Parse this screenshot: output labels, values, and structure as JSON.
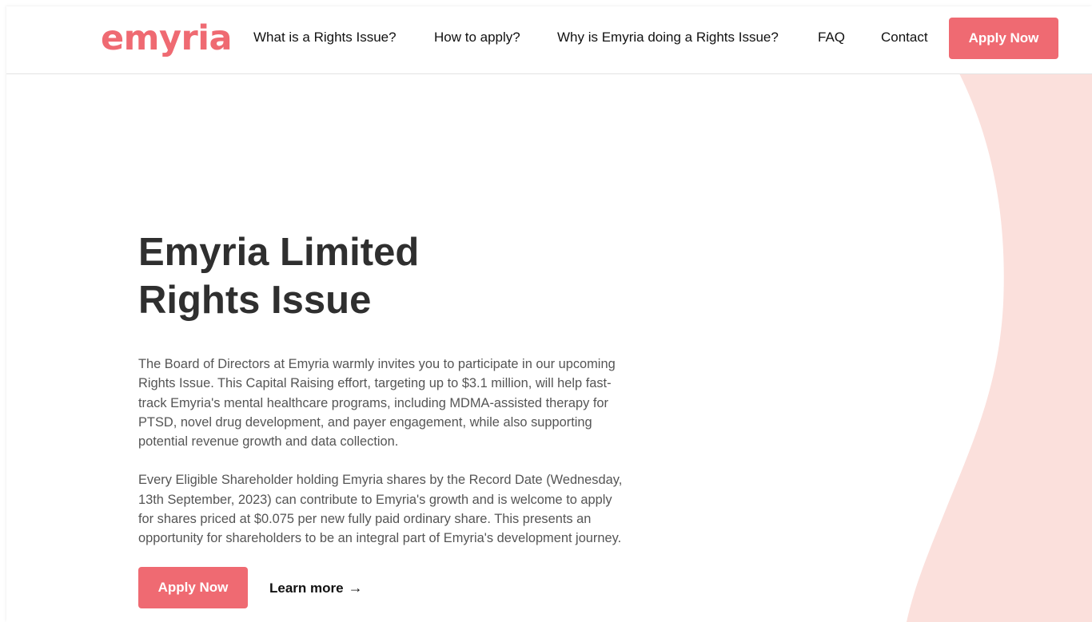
{
  "brand": {
    "logo_text": "emyria",
    "accent_color": "#ef6a72",
    "wave_color": "#fbe0dc"
  },
  "nav": {
    "items": [
      {
        "label": "What is a Rights Issue?"
      },
      {
        "label": "How to apply?"
      },
      {
        "label": "Why is Emyria doing a Rights Issue?"
      },
      {
        "label": "FAQ"
      },
      {
        "label": "Contact"
      }
    ],
    "apply_label": "Apply Now"
  },
  "hero": {
    "title_line1": "Emyria Limited",
    "title_line2": "Rights Issue",
    "paragraph1": "The Board of Directors at Emyria warmly invites you to participate in our upcoming Rights Issue. This Capital Raising effort, targeting up to $3.1 million, will help fast-track Emyria's mental healthcare programs, including MDMA-assisted therapy for PTSD, novel drug development, and payer engagement, while also supporting potential revenue growth and data collection.",
    "paragraph2": "Every Eligible Shareholder holding Emyria shares by the Record Date (Wednesday, 13th September, 2023) can contribute to Emyria's growth and is welcome to apply for shares priced at $0.075 per new fully paid ordinary share. This presents an opportunity for shareholders to be an integral part of Emyria's development journey.",
    "apply_label": "Apply Now",
    "learn_more_label": "Learn more",
    "learn_more_icon": "arrow-right-icon"
  }
}
